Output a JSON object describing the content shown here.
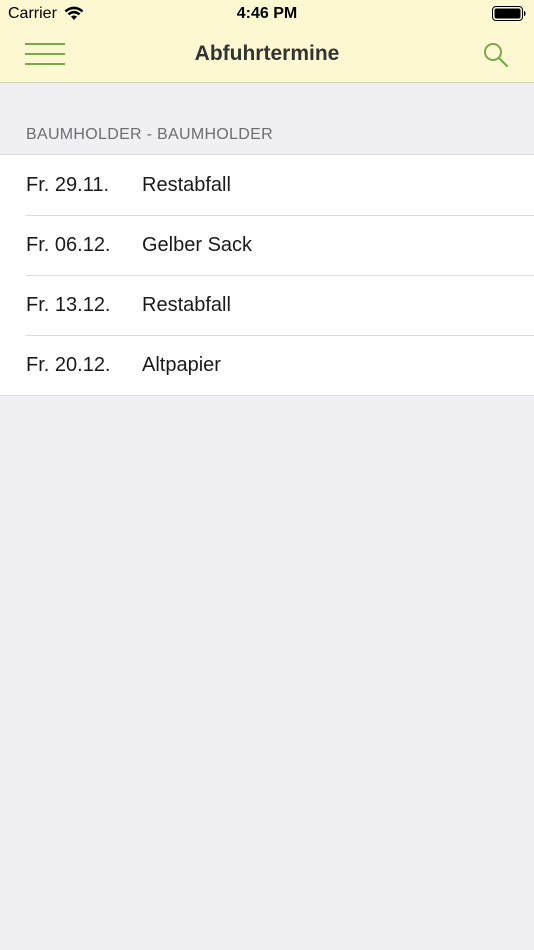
{
  "status_bar": {
    "carrier": "Carrier",
    "time": "4:46 PM"
  },
  "nav": {
    "title": "Abfuhrtermine",
    "menu_icon": "hamburger-menu-icon",
    "search_icon": "search-icon"
  },
  "colors": {
    "header_bg": "#fcf9d2",
    "accent_green": "#7ba84b",
    "page_bg": "#efeff4"
  },
  "section": {
    "header": "BAUMHOLDER - BAUMHOLDER"
  },
  "entries": [
    {
      "date": "Fr. 29.11.",
      "type": "Restabfall"
    },
    {
      "date": "Fr. 06.12.",
      "type": "Gelber Sack"
    },
    {
      "date": "Fr. 13.12.",
      "type": "Restabfall"
    },
    {
      "date": "Fr. 20.12.",
      "type": "Altpapier"
    }
  ]
}
